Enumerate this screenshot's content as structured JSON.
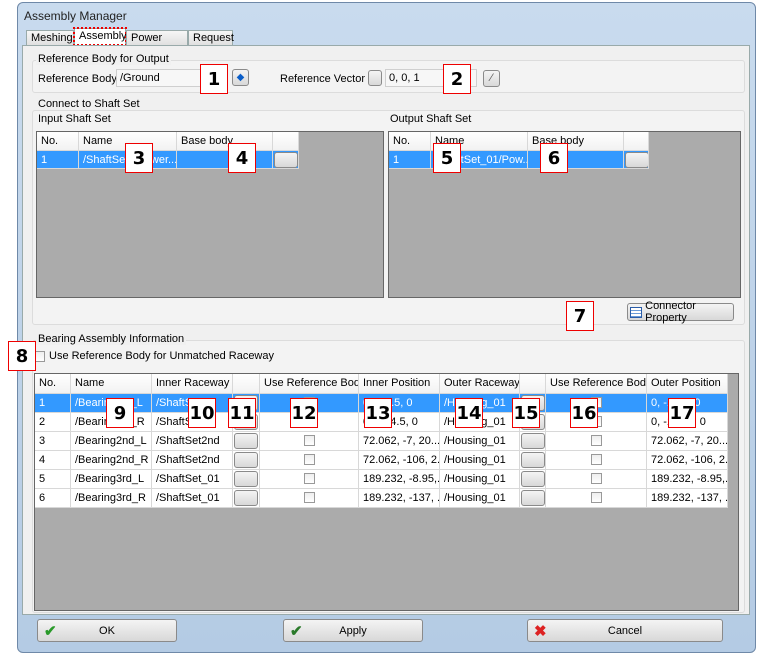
{
  "window": {
    "title": "Assembly Manager"
  },
  "tabs": [
    {
      "label": "Meshing"
    },
    {
      "label": "Assembly",
      "active": true
    },
    {
      "label": "Power Flow"
    },
    {
      "label": "Request"
    }
  ],
  "reference": {
    "group_label": "Reference Body for Output",
    "body_label": "Reference Body",
    "body_value": "/Ground",
    "vector_label": "Reference Vector",
    "vector_value": "0, 0, 1"
  },
  "shaft": {
    "group_label": "Connect to Shaft Set",
    "input_label": "Input Shaft Set",
    "output_label": "Output Shaft Set",
    "columns": [
      "No.",
      "Name",
      "Base body",
      ""
    ],
    "input_rows": [
      [
        "1",
        "/ShaftSet1/Power...",
        ""
      ]
    ],
    "output_rows": [
      [
        "1",
        "/ShaftSet_01/Pow...",
        ""
      ]
    ],
    "connector_button": "Connector Property"
  },
  "bearing": {
    "group_label": "Bearing Assembly Information",
    "unmatched_label": "Use Reference Body for Unmatched Raceway",
    "columns": [
      "No.",
      "Name",
      "Inner Raceway",
      "",
      "Use Reference Body",
      "Inner Position",
      "Outer Raceway",
      "",
      "Use Reference Body",
      "Outer Position"
    ],
    "rows": [
      [
        "1",
        "/Bearing1st_L",
        "/ShaftSet1st",
        "",
        "",
        "0, -15.5, 0",
        "/Housing_01",
        "",
        "",
        "0, -15.5, 0"
      ],
      [
        "2",
        "/Bearing1st_R",
        "/ShaftSet1st",
        "",
        "",
        "0, -114.5, 0",
        "/Housing_01",
        "",
        "",
        "0, -114.5, 0"
      ],
      [
        "3",
        "/Bearing2nd_L",
        "/ShaftSet2nd",
        "",
        "",
        "72.062, -7, 20....",
        "/Housing_01",
        "",
        "",
        "72.062, -7, 20...."
      ],
      [
        "4",
        "/Bearing2nd_R",
        "/ShaftSet2nd",
        "",
        "",
        "72.062, -106, 2...",
        "/Housing_01",
        "",
        "",
        "72.062, -106, 2..."
      ],
      [
        "5",
        "/Bearing3rd_L",
        "/ShaftSet_01",
        "",
        "",
        "189.232, -8.95,...",
        "/Housing_01",
        "",
        "",
        "189.232, -8.95,..."
      ],
      [
        "6",
        "/Bearing3rd_R",
        "/ShaftSet_01",
        "",
        "",
        "189.232, -137, ...",
        "/Housing_01",
        "",
        "",
        "189.232, -137, ..."
      ]
    ]
  },
  "buttons": {
    "ok": "OK",
    "apply": "Apply",
    "cancel": "Cancel"
  },
  "callouts": [
    "1",
    "2",
    "3",
    "4",
    "5",
    "6",
    "7",
    "8",
    "9",
    "10",
    "11",
    "12",
    "13",
    "14",
    "15",
    "16",
    "17"
  ],
  "colors": {
    "selection": "#3399ff",
    "callout_border": "#ee0000"
  }
}
